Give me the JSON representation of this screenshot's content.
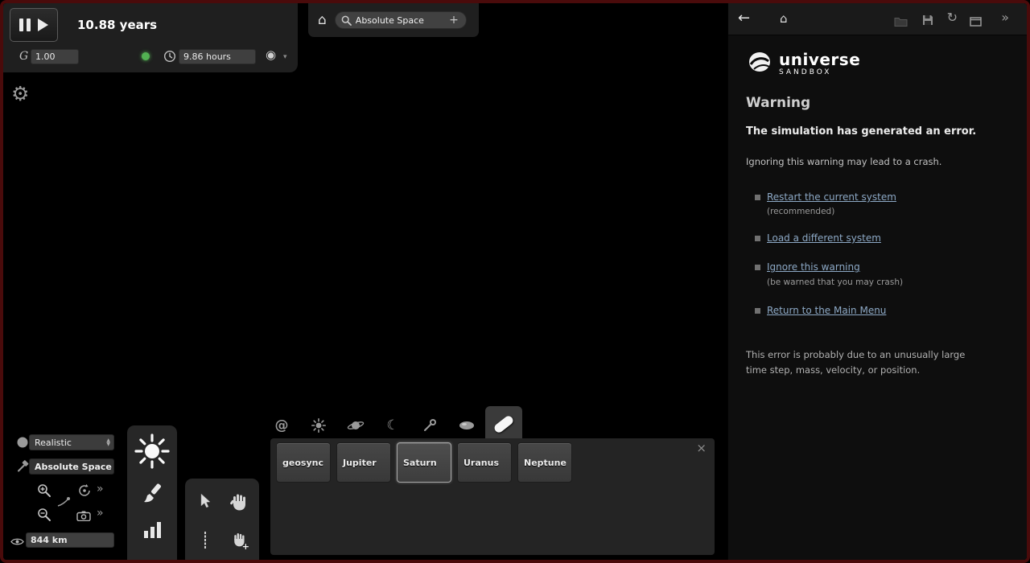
{
  "icons": {
    "home": "⌂",
    "back": "←",
    "refresh": "↻",
    "chevrons": "»",
    "gear": "⚙",
    "target": "◉",
    "caret": "▾",
    "plus": "+",
    "close": "×",
    "moon": "☾",
    "galaxy": "@",
    "spin_up": "▲",
    "spin_down": "▼",
    "fast": "»"
  },
  "time_panel": {
    "elapsed": "10.88 years",
    "gravity_label": "G",
    "gravity_value": "1.00",
    "time_step": "9.86 hours"
  },
  "top_bar": {
    "search_value": "Absolute Space"
  },
  "right_panel": {
    "logo": {
      "line1": "universe",
      "line2": "SANDBOX"
    },
    "warning_title": "Warning",
    "error_heading": "The simulation has generated an error.",
    "error_subtext": "Ignoring this warning may lead to a crash.",
    "options": [
      {
        "label": "Restart the current system",
        "note": "(recommended)"
      },
      {
        "label": "Load a different system"
      },
      {
        "label": "Ignore this warning",
        "note": "(be warned that you may crash)"
      },
      {
        "label": "Return to the Main Menu"
      }
    ],
    "footer_line1": "This error is probably due to an unusually large",
    "footer_line2": "time step, mass, velocity, or position."
  },
  "view_controls": {
    "render_mode": "Realistic",
    "reference_frame": "Absolute Space",
    "view_scale": "844 km"
  },
  "object_panel": {
    "buttons": [
      "geosync",
      "Jupiter",
      "Saturn",
      "Uranus",
      "Neptune"
    ],
    "selected": "Saturn"
  },
  "colors": {
    "window_border": "#4a0b0b",
    "link": "#8da9c6",
    "running_indicator": "#52b152"
  }
}
